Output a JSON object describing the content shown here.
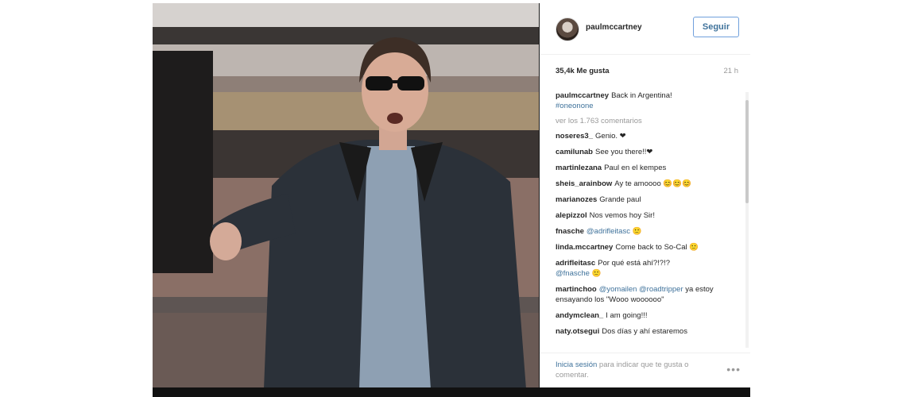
{
  "post": {
    "username": "paulmccartney",
    "follow_label": "Seguir",
    "likes": "35,4k Me gusta",
    "time": "21 h",
    "caption": {
      "user": "paulmccartney",
      "text": "Back in Argentina!",
      "hashtag": "#oneonone"
    },
    "view_all": "ver los 1.763 comentarios",
    "comments": [
      {
        "user": "noseres3_",
        "text": "Genio. ❤"
      },
      {
        "user": "camilunab",
        "text": "See you there!!❤"
      },
      {
        "user": "martinlezana",
        "text": "Paul en el kempes"
      },
      {
        "user": "sheis_arainbow",
        "text": "Ay te amoooo 😊😊😊"
      },
      {
        "user": "marianozes",
        "text": "Grande paul"
      },
      {
        "user": "alepizzol",
        "text": "Nos vemos hoy Sir!"
      },
      {
        "user": "fnasche",
        "mention": "@adrifleitasc",
        "text": "🙂"
      },
      {
        "user": "linda.mccartney",
        "text": "Come back to So-Cal 🙂"
      },
      {
        "user": "adrifleitasc",
        "text": "Por qué está ahí?!?!?",
        "mention2": "@fnasche",
        "text2": "🙂"
      },
      {
        "user": "martinchoo",
        "mention": "@yomailen @roadtripper",
        "text": "ya estoy ensayando los \"Wooo woooooo\""
      },
      {
        "user": "andymclean_",
        "text": "I am going!!!"
      },
      {
        "user": "naty.otsegui",
        "text": "Dos días y ahí estaremos"
      }
    ],
    "footer": {
      "login": "Inicia sesión",
      "rest": "para indicar que te gusta o comentar."
    },
    "more": "•••"
  }
}
